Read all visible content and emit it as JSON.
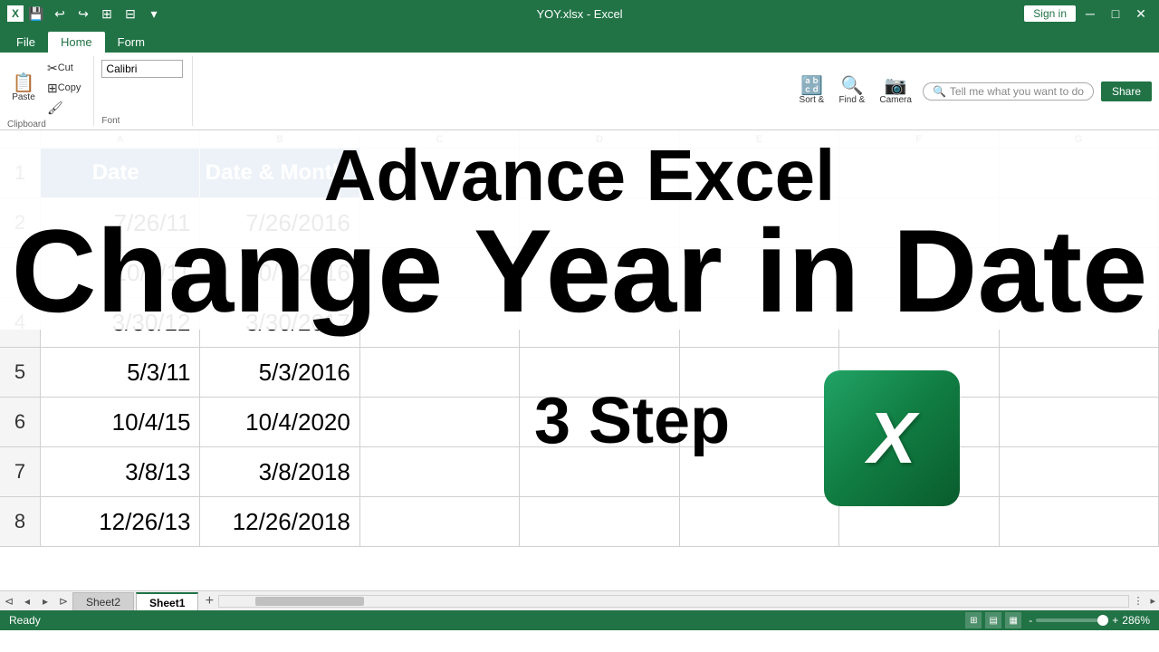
{
  "titleBar": {
    "filename": "YOY.xlsx - Excel",
    "signinLabel": "Sign in",
    "windowButtons": [
      "─",
      "□",
      "✕"
    ]
  },
  "quickAccess": {
    "icons": [
      "💾",
      "↩",
      "↪",
      "⊞",
      "⊟",
      "▾"
    ]
  },
  "ribbonTabs": {
    "tabs": [
      "File",
      "Home",
      "Form"
    ]
  },
  "ribbon": {
    "fontName": "Calibri",
    "sections": [
      {
        "label": "Paste",
        "icon": "📋"
      },
      {
        "label": "Cut",
        "icon": "✂"
      },
      {
        "label": "Copy",
        "icon": "⊞"
      },
      {
        "label": "Format Painter",
        "icon": "🖌"
      }
    ],
    "sortFind": "Sort &",
    "findReplace": "Find &",
    "camera": "Camera",
    "tellMe": "Tell me what you want to do",
    "share": "Share"
  },
  "overlay": {
    "advanceExcel": "Advance Excel",
    "changeYearInDate": "Change Year in Date"
  },
  "spreadsheet": {
    "columns": [
      "A",
      "B",
      "C",
      "D",
      "E",
      "F",
      "G"
    ],
    "rows": [
      {
        "rowNum": "1",
        "cells": [
          {
            "value": "Date",
            "type": "header"
          },
          {
            "value": "Date & Month",
            "type": "header"
          },
          {
            "value": "",
            "type": "empty"
          },
          {
            "value": "",
            "type": "empty"
          },
          {
            "value": "",
            "type": "empty"
          },
          {
            "value": "",
            "type": "empty"
          },
          {
            "value": "",
            "type": "empty"
          }
        ]
      },
      {
        "rowNum": "2",
        "cells": [
          {
            "value": "7/26/11",
            "type": "data"
          },
          {
            "value": "7/26/2016",
            "type": "data"
          },
          {
            "value": "",
            "type": "empty"
          },
          {
            "value": "",
            "type": "empty"
          },
          {
            "value": "",
            "type": "empty"
          },
          {
            "value": "",
            "type": "empty"
          },
          {
            "value": "",
            "type": "empty"
          }
        ]
      },
      {
        "rowNum": "3",
        "cells": [
          {
            "value": "10/7/11",
            "type": "data"
          },
          {
            "value": "10/7/2016",
            "type": "data"
          },
          {
            "value": "",
            "type": "empty"
          },
          {
            "value": "",
            "type": "empty"
          },
          {
            "value": "",
            "type": "empty"
          },
          {
            "value": "",
            "type": "empty"
          },
          {
            "value": "",
            "type": "empty"
          }
        ]
      },
      {
        "rowNum": "4",
        "cells": [
          {
            "value": "3/30/12",
            "type": "data"
          },
          {
            "value": "3/30/2017",
            "type": "data"
          },
          {
            "value": "",
            "type": "empty"
          },
          {
            "value": "",
            "type": "empty"
          },
          {
            "value": "",
            "type": "empty"
          },
          {
            "value": "",
            "type": "empty"
          },
          {
            "value": "",
            "type": "empty"
          }
        ]
      },
      {
        "rowNum": "5",
        "cells": [
          {
            "value": "5/3/11",
            "type": "data"
          },
          {
            "value": "5/3/2016",
            "type": "data"
          },
          {
            "value": "",
            "type": "empty"
          },
          {
            "value": "",
            "type": "empty"
          },
          {
            "value": "",
            "type": "empty"
          },
          {
            "value": "",
            "type": "empty"
          },
          {
            "value": "",
            "type": "empty"
          }
        ]
      },
      {
        "rowNum": "6",
        "cells": [
          {
            "value": "10/4/15",
            "type": "data"
          },
          {
            "value": "10/4/2020",
            "type": "data"
          },
          {
            "value": "",
            "type": "empty"
          },
          {
            "value": "",
            "type": "empty"
          },
          {
            "value": "",
            "type": "empty"
          },
          {
            "value": "",
            "type": "empty"
          },
          {
            "value": "",
            "type": "empty"
          }
        ]
      },
      {
        "rowNum": "7",
        "cells": [
          {
            "value": "3/8/13",
            "type": "data"
          },
          {
            "value": "3/8/2018",
            "type": "data"
          },
          {
            "value": "",
            "type": "empty"
          },
          {
            "value": "",
            "type": "empty"
          },
          {
            "value": "",
            "type": "empty"
          },
          {
            "value": "",
            "type": "empty"
          },
          {
            "value": "",
            "type": "empty"
          }
        ]
      },
      {
        "rowNum": "8",
        "cells": [
          {
            "value": "12/26/13",
            "type": "data"
          },
          {
            "value": "12/26/2018",
            "type": "data"
          },
          {
            "value": "",
            "type": "empty"
          },
          {
            "value": "",
            "type": "empty"
          },
          {
            "value": "",
            "type": "empty"
          },
          {
            "value": "",
            "type": "empty"
          },
          {
            "value": "",
            "type": "empty"
          }
        ]
      }
    ],
    "threeStep": "3 Step"
  },
  "sheets": {
    "tabs": [
      "Sheet2",
      "Sheet1"
    ],
    "active": "Sheet1",
    "addLabel": "+"
  },
  "statusBar": {
    "ready": "Ready",
    "zoom": "286%",
    "zoomMinus": "-",
    "zoomPlus": "+"
  }
}
